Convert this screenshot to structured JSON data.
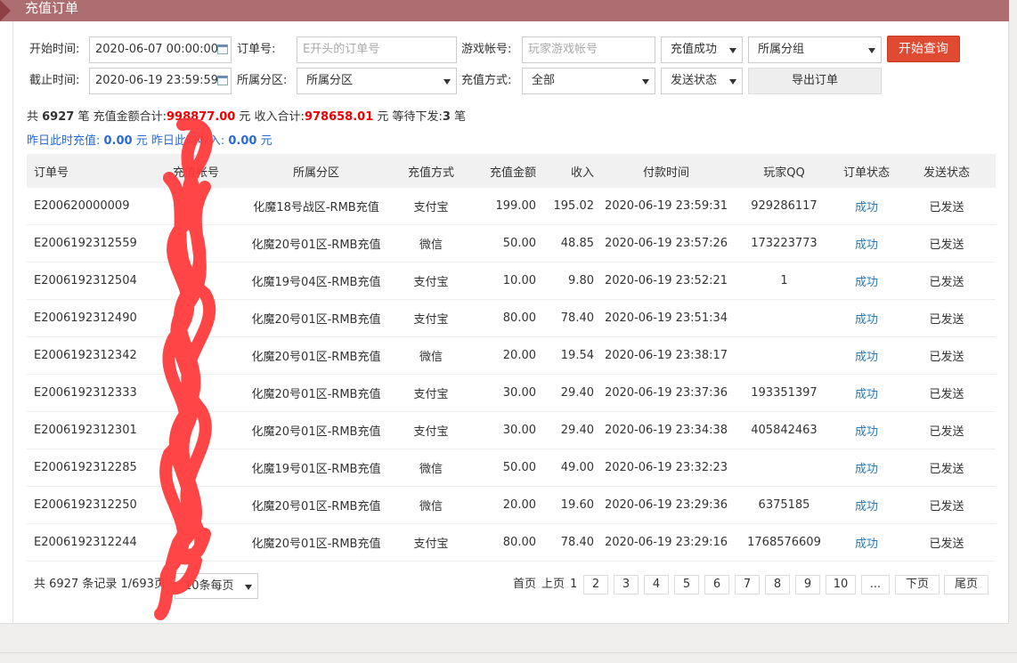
{
  "title": "充值订单",
  "filters": {
    "start_label": "开始时间:",
    "start_value": "2020-06-07 00:00:00",
    "end_label": "截止时间:",
    "end_value": "2020-06-19 23:59:59",
    "order_label": "订单号:",
    "order_placeholder": "E开头的订单号",
    "zone_label": "所属分区:",
    "zone_value": "所属分区",
    "account_label": "游戏帐号:",
    "account_placeholder": "玩家游戏帐号",
    "method_label": "充值方式:",
    "method_value": "全部",
    "status_value": "充值成功",
    "group_value": "所属分组",
    "send_value": "发送状态",
    "search_button": "开始查询",
    "export_button": "导出订单"
  },
  "summary": {
    "t1": "共 ",
    "count": "6927",
    "t2": " 笔   充值金额合计:",
    "total": "998877.00",
    "t3": " 元   收入合计:",
    "income": "978658.01",
    "t4": " 元   等待下发:",
    "pending": "3",
    "t5": " 笔",
    "y1": "昨日此时充值: ",
    "yrecharge": "0.00",
    "y2": " 元   昨日此时收入: ",
    "yincome": "0.00",
    "y3": " 元"
  },
  "table": {
    "headers": [
      "订单号",
      "充值帐号",
      "所属分区",
      "充值方式",
      "充值金额",
      "收入",
      "付款时间",
      "玩家QQ",
      "订单状态",
      "发送状态"
    ],
    "rows": [
      [
        "E200620000009",
        "",
        "化魔18号战区-RMB充值",
        "支付宝",
        "199.00",
        "195.02",
        "2020-06-19 23:59:31",
        "929286117",
        "成功",
        "已发送"
      ],
      [
        "E2006192312559",
        "",
        "化魔20号01区-RMB充值",
        "微信",
        "50.00",
        "48.85",
        "2020-06-19 23:57:26",
        "173223773",
        "成功",
        "已发送"
      ],
      [
        "E2006192312504",
        "",
        "化魔19号04区-RMB充值",
        "支付宝",
        "10.00",
        "9.80",
        "2020-06-19 23:52:21",
        "1",
        "成功",
        "已发送"
      ],
      [
        "E2006192312490",
        "",
        "化魔20号01区-RMB充值",
        "支付宝",
        "80.00",
        "78.40",
        "2020-06-19 23:51:34",
        "",
        "成功",
        "已发送"
      ],
      [
        "E2006192312342",
        "",
        "化魔20号01区-RMB充值",
        "微信",
        "20.00",
        "19.54",
        "2020-06-19 23:38:17",
        "",
        "成功",
        "已发送"
      ],
      [
        "E2006192312333",
        "",
        "化魔20号01区-RMB充值",
        "支付宝",
        "30.00",
        "29.40",
        "2020-06-19 23:37:36",
        "193351397",
        "成功",
        "已发送"
      ],
      [
        "E2006192312301",
        "",
        "化魔20号01区-RMB充值",
        "支付宝",
        "30.00",
        "29.40",
        "2020-06-19 23:34:38",
        "405842463",
        "成功",
        "已发送"
      ],
      [
        "E2006192312285",
        "",
        "化魔19号01区-RMB充值",
        "微信",
        "50.00",
        "49.00",
        "2020-06-19 23:32:23",
        "",
        "成功",
        "已发送"
      ],
      [
        "E2006192312250",
        "",
        "化魔20号01区-RMB充值",
        "微信",
        "20.00",
        "19.60",
        "2020-06-19 23:29:36",
        "6375185",
        "成功",
        "已发送"
      ],
      [
        "E2006192312244",
        "",
        "化魔20号01区-RMB充值",
        "支付宝",
        "80.00",
        "78.40",
        "2020-06-19 23:29:16",
        "1768576609",
        "成功",
        "已发送"
      ]
    ]
  },
  "footer": {
    "records": "共 6927 条记录 1/693页",
    "per_page": "10条每页",
    "first": "首页",
    "prev": "上页",
    "current": "1",
    "pages": [
      "2",
      "3",
      "4",
      "5",
      "6",
      "7",
      "8",
      "9",
      "10",
      "..."
    ],
    "next": "下页",
    "last": "尾页"
  },
  "colors": {
    "accent": "#ad6e72",
    "primary_button": "#e04a32",
    "link": "#2a7ab8",
    "highlight": "#e00000",
    "scribble": "#ff3b3b"
  }
}
